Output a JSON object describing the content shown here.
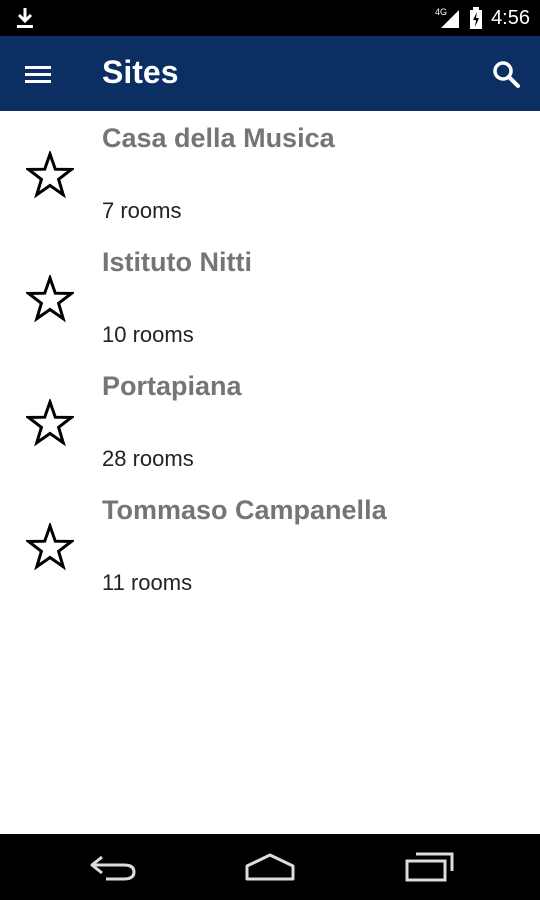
{
  "theme": {
    "accent": "#0b2e63",
    "site_name_color": "#757575"
  },
  "status_bar": {
    "network": "4G",
    "time": "4:56",
    "icons": [
      "download-icon",
      "signal-icon",
      "battery-charging-icon"
    ]
  },
  "app_bar": {
    "title": "Sites",
    "icons": [
      "menu-icon",
      "search-icon"
    ]
  },
  "sites": [
    {
      "name": "Casa della Musica",
      "rooms": "7 rooms",
      "favorite": false
    },
    {
      "name": "Istituto Nitti",
      "rooms": "10 rooms",
      "favorite": false
    },
    {
      "name": "Portapiana",
      "rooms": "28 rooms",
      "favorite": false
    },
    {
      "name": "Tommaso Campanella",
      "rooms": "11 rooms",
      "favorite": false
    }
  ],
  "nav_bar": {
    "icons": [
      "back-icon",
      "home-icon",
      "recents-icon"
    ]
  }
}
